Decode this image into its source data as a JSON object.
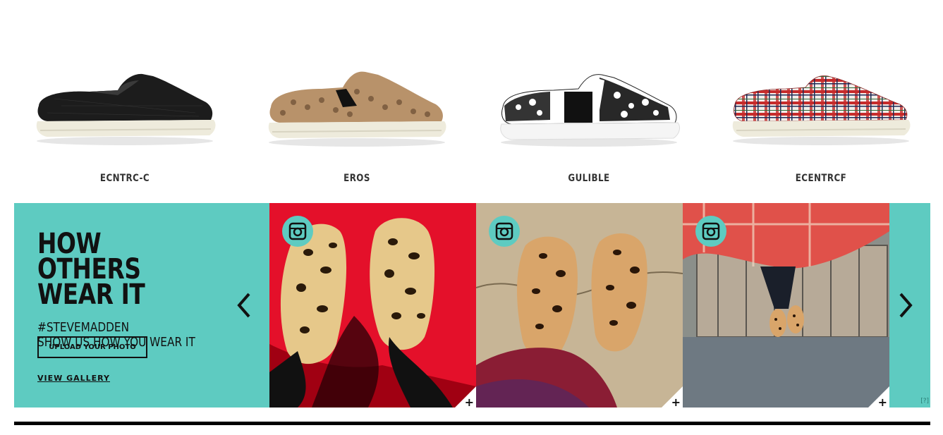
{
  "products": [
    {
      "name": "ECNTRC-C"
    },
    {
      "name": "EROS"
    },
    {
      "name": "GULIBLE"
    },
    {
      "name": "ECENTRCF"
    }
  ],
  "ugc": {
    "title_line1": "HOW OTHERS",
    "title_line2": "WEAR IT",
    "hashtag": "#STEVEMADDEN",
    "subtitle": "SHOW US HOW YOU WEAR IT",
    "upload_label": "UPLOAD YOUR PHOTO",
    "view_gallery_label": "VIEW GALLERY",
    "help_label": "[?]",
    "plus_label": "+",
    "accent_color": "#5ecbc1",
    "icons": {
      "left_arrow": "chevron-left-icon",
      "right_arrow": "chevron-right-icon",
      "instagram": "instagram-icon"
    }
  }
}
